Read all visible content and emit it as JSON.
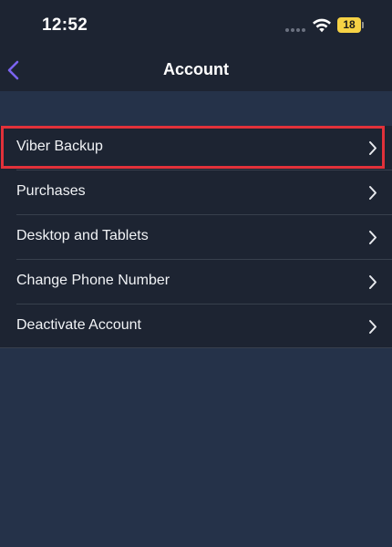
{
  "status_bar": {
    "time": "12:52",
    "battery_level": "18",
    "signal_icon": "signal-dots-icon",
    "wifi_icon": "wifi-icon",
    "battery_color": "#f6d245"
  },
  "nav": {
    "title": "Account",
    "back_icon": "chevron-left-icon",
    "accent_color": "#7b63f0"
  },
  "menu": {
    "items": [
      {
        "label": "Viber Backup",
        "highlighted": true
      },
      {
        "label": "Purchases"
      },
      {
        "label": "Desktop and Tablets"
      },
      {
        "label": "Change Phone Number"
      },
      {
        "label": "Deactivate Account"
      }
    ]
  },
  "highlight_color": "#e2313a"
}
